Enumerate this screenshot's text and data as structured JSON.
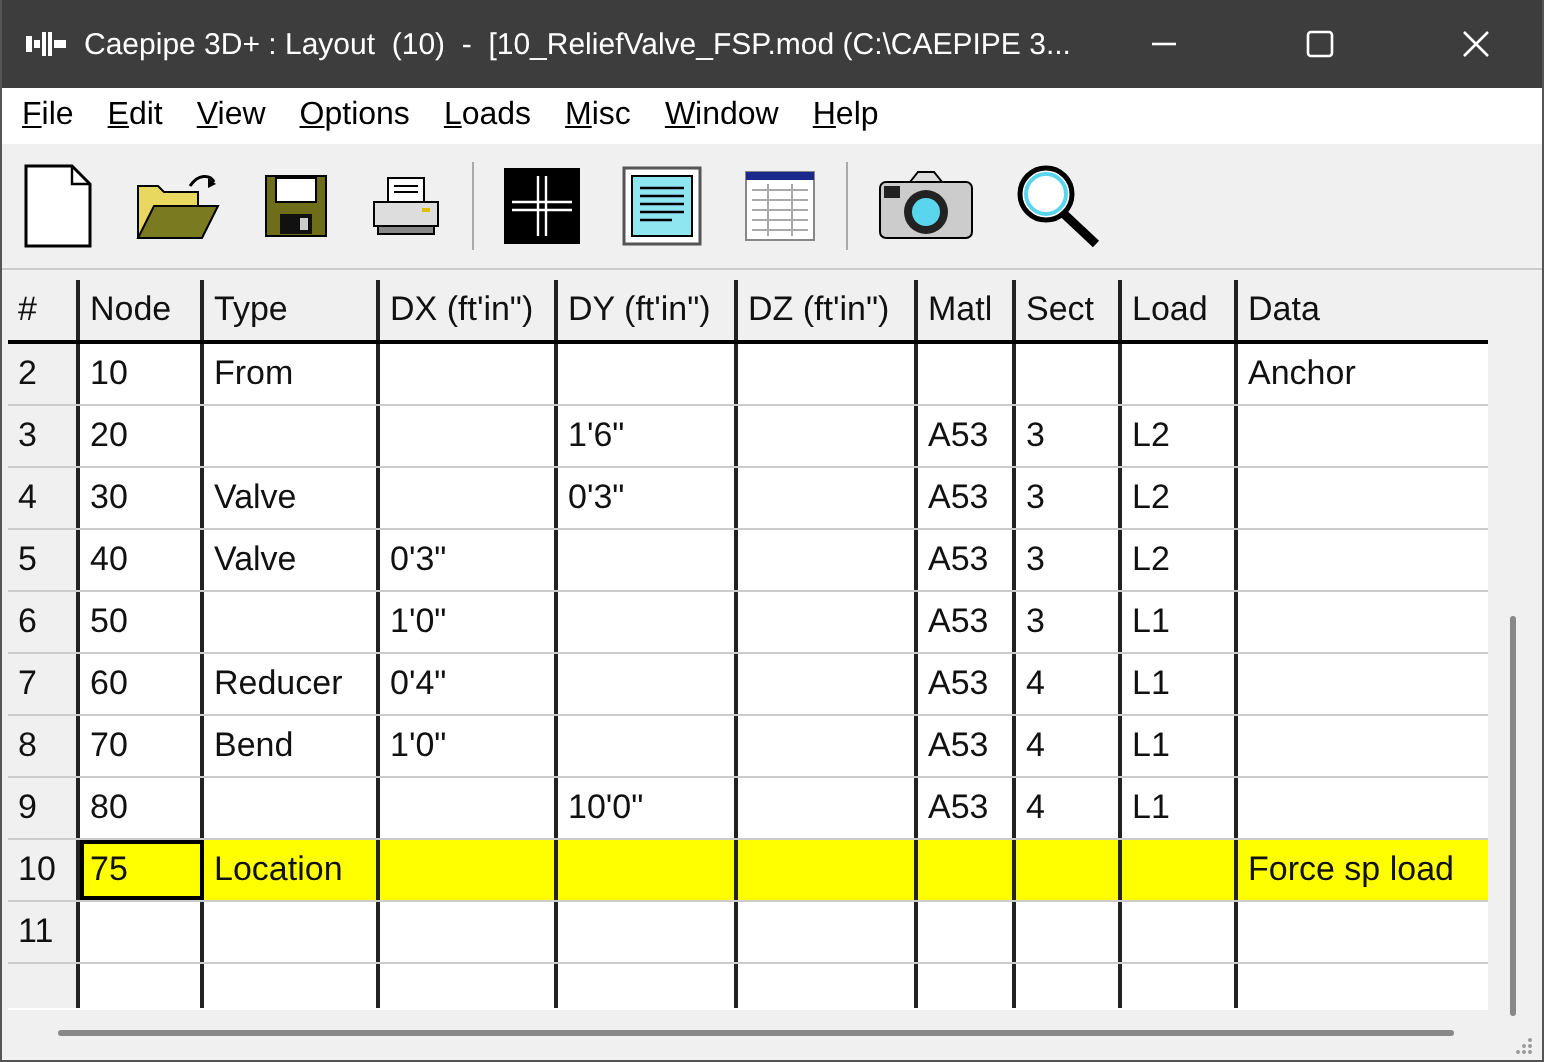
{
  "window": {
    "title": "Caepipe 3D+ : Layout  (10)  -  [10_ReliefValve_FSP.mod (C:\\CAEPIPE 3..."
  },
  "menu": [
    "File",
    "Edit",
    "View",
    "Options",
    "Loads",
    "Misc",
    "Window",
    "Help"
  ],
  "table": {
    "columns": [
      "#",
      "Node",
      "Type",
      "DX (ft'in\")",
      "DY (ft'in\")",
      "DZ (ft'in\")",
      "Matl",
      "Sect",
      "Load",
      "Data"
    ],
    "rows": [
      {
        "cells": [
          "2",
          "10",
          "From",
          "",
          "",
          "",
          "",
          "",
          "",
          "Anchor"
        ],
        "selected": false
      },
      {
        "cells": [
          "3",
          "20",
          "",
          "",
          "1'6\"",
          "",
          "A53",
          "3",
          "L2",
          ""
        ],
        "selected": false
      },
      {
        "cells": [
          "4",
          "30",
          "Valve",
          "",
          "0'3\"",
          "",
          "A53",
          "3",
          "L2",
          ""
        ],
        "selected": false
      },
      {
        "cells": [
          "5",
          "40",
          "Valve",
          "0'3\"",
          "",
          "",
          "A53",
          "3",
          "L2",
          ""
        ],
        "selected": false
      },
      {
        "cells": [
          "6",
          "50",
          "",
          "1'0\"",
          "",
          "",
          "A53",
          "3",
          "L1",
          ""
        ],
        "selected": false
      },
      {
        "cells": [
          "7",
          "60",
          "Reducer",
          "0'4\"",
          "",
          "",
          "A53",
          "4",
          "L1",
          ""
        ],
        "selected": false
      },
      {
        "cells": [
          "8",
          "70",
          "Bend",
          "1'0\"",
          "",
          "",
          "A53",
          "4",
          "L1",
          ""
        ],
        "selected": false
      },
      {
        "cells": [
          "9",
          "80",
          "",
          "",
          "10'0\"",
          "",
          "A53",
          "4",
          "L1",
          ""
        ],
        "selected": false
      },
      {
        "cells": [
          "10",
          "75",
          "Location",
          "",
          "",
          "",
          "",
          "",
          "",
          "Force sp load"
        ],
        "selected": true
      },
      {
        "cells": [
          "11",
          "",
          "",
          "",
          "",
          "",
          "",
          "",
          "",
          ""
        ],
        "selected": false
      }
    ]
  }
}
